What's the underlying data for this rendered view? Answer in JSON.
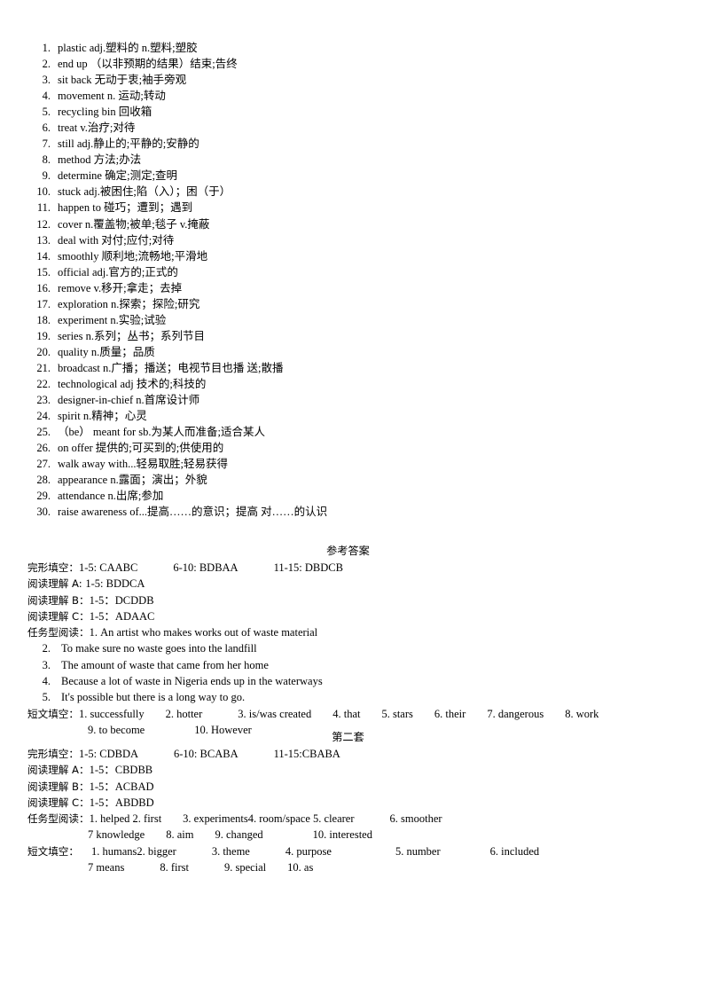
{
  "vocabulary": [
    {
      "num": "1.",
      "text": "plastic adj.塑料的 n.塑料;塑胶"
    },
    {
      "num": "2.",
      "text": "end up （以非预期的结果）结束;告终"
    },
    {
      "num": "3.",
      "text": "sit back 无动于衷;袖手旁观"
    },
    {
      "num": "4.",
      "text": "movement n. 运动;转动"
    },
    {
      "num": "5.",
      "text": "recycling bin 回收箱"
    },
    {
      "num": "6.",
      "text": "treat v.治疗;对待"
    },
    {
      "num": "7.",
      "text": "still adj.静止的;平静的;安静的"
    },
    {
      "num": "8.",
      "text": "method 方法;办法"
    },
    {
      "num": "9.",
      "text": "determine 确定;测定;查明"
    },
    {
      "num": "10.",
      "text": "stuck adj.被困住;陷（入）；困（于）"
    },
    {
      "num": "11.",
      "text": "happen to 碰巧；遭到；遇到"
    },
    {
      "num": "12.",
      "text": "cover n.覆盖物;被单;毯子 v.掩蔽"
    },
    {
      "num": "13.",
      "text": "deal with 对付;应付;对待"
    },
    {
      "num": "14.",
      "text": "smoothly 顺利地;流畅地;平滑地"
    },
    {
      "num": "15.",
      "text": "official adj.官方的;正式的"
    },
    {
      "num": "16.",
      "text": "remove v.移开;拿走；去掉"
    },
    {
      "num": "17.",
      "text": "exploration n.探索；探险;研究"
    },
    {
      "num": "18.",
      "text": "experiment n.实验;试验"
    },
    {
      "num": "19.",
      "text": "series n.系列；丛书；系列节目"
    },
    {
      "num": "20.",
      "text": "quality n.质量；品质"
    },
    {
      "num": "21.",
      "text": "broadcast n.广播；播送；电视节目也播 送;散播"
    },
    {
      "num": "22.",
      "text": "technological adj 技术的;科技的"
    },
    {
      "num": "23.",
      "text": "designer-in-chief n.首席设计师"
    },
    {
      "num": "24.",
      "text": "spirit n.精神；心灵"
    },
    {
      "num": "25.",
      "text": "（be） meant for sb.为某人而准备;适合某人"
    },
    {
      "num": "26.",
      "text": "on offer 提供的;可买到的;供使用的"
    },
    {
      "num": "27.",
      "text": "walk away with...轻易取胜;轻易获得"
    },
    {
      "num": "28.",
      "text": "appearance n.露面；演出；外貌"
    },
    {
      "num": "29.",
      "text": "attendance n.出席;参加"
    },
    {
      "num": "30.",
      "text": "raise awareness of...提高……的意识；提高 对……的认识"
    }
  ],
  "set_one": {
    "heading": "参考答案",
    "cloze": {
      "label": "完形填空：",
      "g1": "1-5: CAABC",
      "g2": "6-10: BDBAA",
      "g3": "11-15: DBDCB"
    },
    "reading_a": {
      "label": "阅读理解 A: ",
      "answers": "1-5: BDDCA"
    },
    "reading_b": {
      "label": "阅读理解 B：",
      "answers": "1-5：DCDDB"
    },
    "reading_c": {
      "label": "阅读理解 C：",
      "answers": "1-5：ADAAC"
    },
    "task_reading": {
      "label": "任务型阅读：",
      "items": [
        {
          "num": "1.",
          "text": "An artist who makes works out of waste material"
        },
        {
          "num": "2.",
          "text": "To make sure no waste goes into the landfill"
        },
        {
          "num": "3.",
          "text": "The amount of waste that came from her home"
        },
        {
          "num": "4.",
          "text": "Because a lot of waste in Nigeria ends up in the waterways"
        },
        {
          "num": "5.",
          "text": "It's possible but there is a long way to go."
        }
      ]
    },
    "passage_fill": {
      "label": "短文填空：",
      "row1": [
        "1. successfully",
        "2. hotter",
        "3. is/was created",
        "4. that",
        "5. stars",
        "6. their",
        "7. dangerous",
        "8. work"
      ],
      "row2": [
        "9. to become",
        "10. However"
      ]
    }
  },
  "set_two": {
    "heading": "第二套",
    "cloze": {
      "label": "完形填空：",
      "g1": "1-5: CDBDA",
      "g2": "6-10: BCABA",
      "g3": "11-15:CBABA"
    },
    "reading_a": {
      "label": "阅读理解 A：",
      "answers": "1-5：CBDBB"
    },
    "reading_b": {
      "label": "阅读理解 B：",
      "answers": "1-5：ACBAD"
    },
    "reading_c": {
      "label": "阅读理解 C：",
      "answers": "1-5：ABDBD"
    },
    "task_reading": {
      "label": "任务型阅读：",
      "row1": [
        "1. helped",
        "2. first",
        "3. experiments",
        "4. room/space",
        "5. clearer",
        "6. smoother"
      ],
      "row2": [
        "7 knowledge",
        "8. aim",
        "9. changed",
        "10. interested"
      ]
    },
    "passage_fill": {
      "label": "短文填空：",
      "row1": [
        "1. humans",
        "2. bigger",
        "3. theme",
        "4. purpose",
        "5. number",
        "6. included"
      ],
      "row2": [
        "7 means",
        "8. first",
        "9. special",
        "10. as"
      ]
    }
  }
}
